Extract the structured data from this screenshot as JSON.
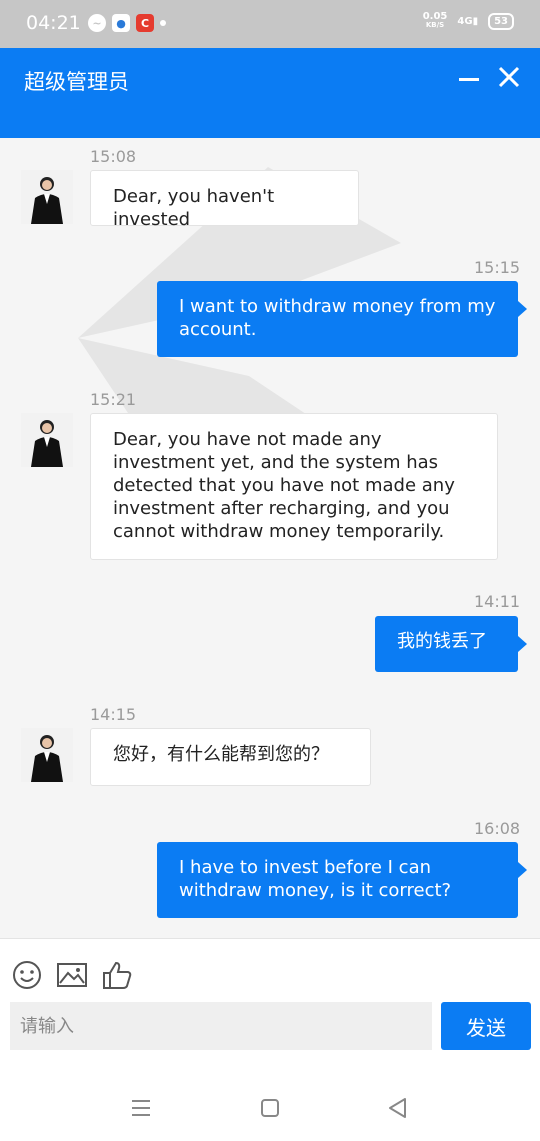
{
  "status_bar": {
    "time": "04:21",
    "net_speed": "0.05",
    "net_unit": "KB/S",
    "signal": "4G",
    "battery": "53"
  },
  "header": {
    "title": "超级管理员"
  },
  "messages": [
    {
      "time": "15:08",
      "direction": "in",
      "text": "Dear, you haven't invested"
    },
    {
      "time": "15:15",
      "direction": "out",
      "text": "I want to withdraw money from my account."
    },
    {
      "time": "15:21",
      "direction": "in",
      "text": "Dear, you have not made any investment yet, and the system has detected that you have not made any investment after recharging, and you cannot withdraw money temporarily."
    },
    {
      "time": "14:11",
      "direction": "out",
      "text": "我的钱丢了"
    },
    {
      "time": "14:15",
      "direction": "in",
      "text": "您好，有什么能帮到您的？"
    },
    {
      "time": "16:08",
      "direction": "out",
      "text": "I have to invest before I can withdraw money, is it correct?"
    }
  ],
  "composer": {
    "placeholder": "请输入",
    "value": "",
    "send_label": "发送"
  },
  "colors": {
    "brand": "#0b7cf3",
    "status_bar": "#c6c6c6"
  },
  "icons": [
    "emoji-icon",
    "image-icon",
    "thumbs-up-icon",
    "menu-icon",
    "home-square-icon",
    "back-triangle-icon"
  ]
}
